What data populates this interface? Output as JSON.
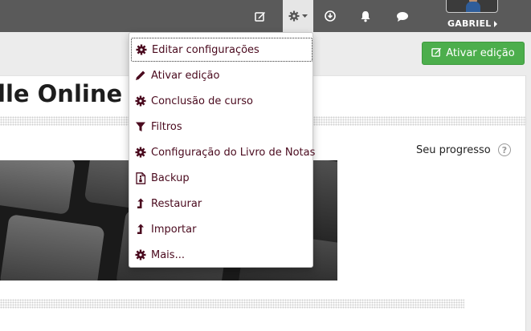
{
  "navbar": {
    "user_name": "GABRIEL",
    "icons": [
      "edit-icon",
      "gear-icon",
      "download-icon",
      "bell-icon",
      "chat-icon"
    ]
  },
  "edit_button": {
    "label": "Ativar edição",
    "color": "#4cae4c"
  },
  "course": {
    "title_visible": "lle Online p"
  },
  "progress": {
    "label": "Seu progresso",
    "help": "?"
  },
  "menu": {
    "items": [
      {
        "label": "Editar configurações",
        "icon": "gear-icon"
      },
      {
        "label": "Ativar edição",
        "icon": "pencil-icon"
      },
      {
        "label": "Conclusão de curso",
        "icon": "gear-icon"
      },
      {
        "label": "Filtros",
        "icon": "filter-icon"
      },
      {
        "label": "Configuração do Livro de Notas",
        "icon": "gear-icon"
      },
      {
        "label": "Backup",
        "icon": "file-icon"
      },
      {
        "label": "Restaurar",
        "icon": "upload-arrow-icon"
      },
      {
        "label": "Importar",
        "icon": "upload-arrow-icon"
      },
      {
        "label": "Mais...",
        "icon": "gear-icon"
      }
    ],
    "text_color": "#4a0a1e"
  },
  "colors": {
    "navbar": "#5a5a5a",
    "accent": "#4cae4c",
    "menu_text": "#4a0a1e"
  }
}
